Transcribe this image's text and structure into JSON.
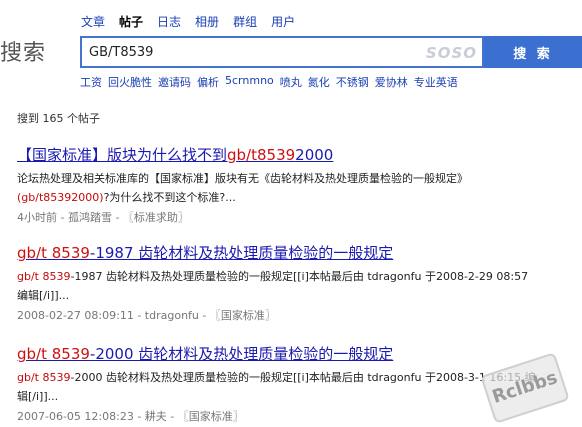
{
  "logo": "搜索",
  "tabs": [
    {
      "label": "文章",
      "active": false
    },
    {
      "label": "帖子",
      "active": true
    },
    {
      "label": "日志",
      "active": false
    },
    {
      "label": "相册",
      "active": false
    },
    {
      "label": "群组",
      "active": false
    },
    {
      "label": "用户",
      "active": false
    }
  ],
  "search": {
    "value": "GB/T8539",
    "brand_mark": "SOSO",
    "button_label": "搜 索"
  },
  "related": [
    "工资",
    "回火脆性",
    "邀请码",
    "偏析",
    "5crnmno",
    "喷丸",
    "氮化",
    "不锈钢",
    "爱协林",
    "专业英语"
  ],
  "count_text": "搜到 165 个帖子",
  "results": [
    {
      "title_pre": "【国家标准】版块为什么找不到",
      "title_hl": "gb/t8539",
      "title_post": "2000",
      "snippet_1": "论坛热处理及相关标准库的【国家标准】版块有无《齿轮材料及热处理质量检验的一般规定》",
      "snippet_2_hl": "(gb/t85392000)",
      "snippet_2": "?为什么找不到这个标准?...",
      "meta_time": "4小时前",
      "meta_author": "孤鸿踏雪",
      "meta_category": "〖标准求助〗"
    },
    {
      "title_hl": "gb/t 8539",
      "title_post": "-1987 齿轮材料及热处理质量检验的一般规定",
      "snippet_hl": "gb/t 8539",
      "snippet_1": "-1987 齿轮材料及热处理质量检验的一般规定[[i]本帖最后由 tdragonfu 于2008-2-29 08:57",
      "snippet_2": "编辑[/i]]...",
      "meta_time": "2008-02-27 08:09:11",
      "meta_author": "tdragonfu",
      "meta_category": "〖国家标准〗"
    },
    {
      "title_hl": "gb/t 8539",
      "title_post": "-2000 齿轮材料及热处理质量检验的一般规定",
      "snippet_hl": "gb/t 8539",
      "snippet_1": "-2000 齿轮材料及热处理质量检验的一般规定[[i]本帖最后由 tdragonfu 于2008-3-1 16:15 编",
      "snippet_2": "辑[/i]]...",
      "meta_time": "2007-06-05 12:08:23",
      "meta_author": "耕夫",
      "meta_category": "〖国家标准〗"
    }
  ],
  "watermark": "Rclbbs"
}
